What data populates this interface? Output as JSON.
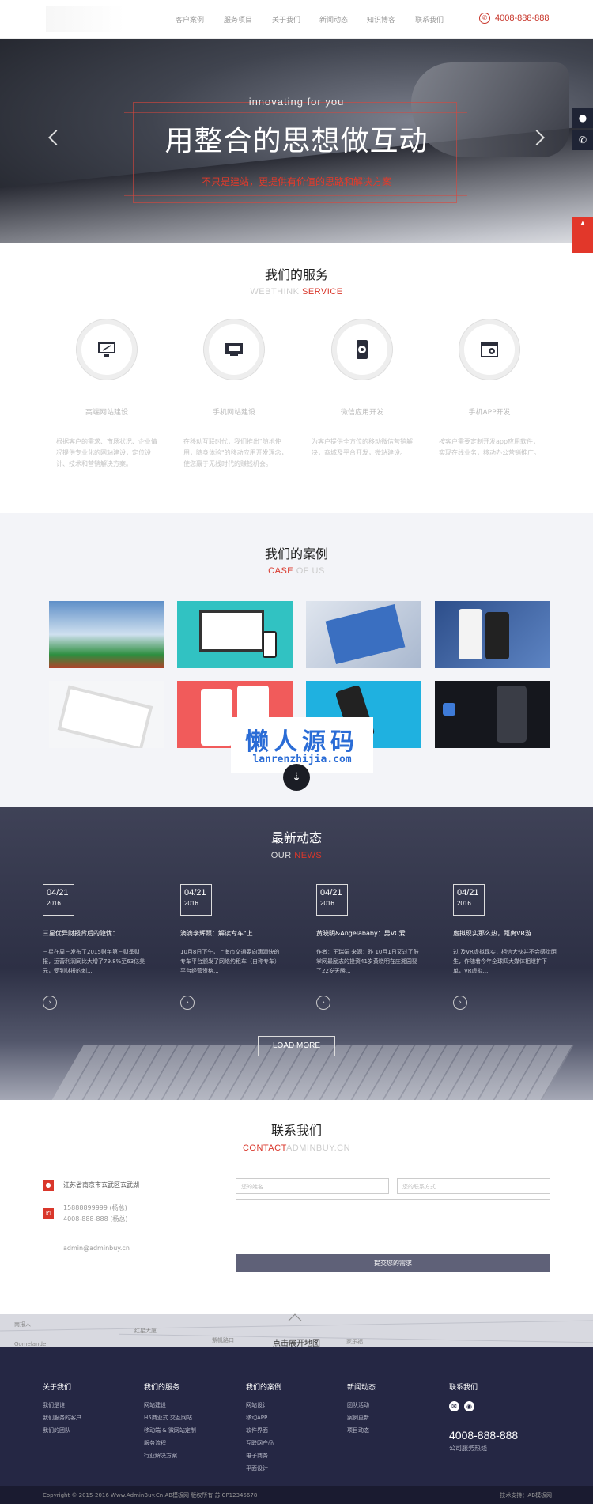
{
  "nav": {
    "items": [
      "客户案例",
      "服务项目",
      "关于我们",
      "新闻动态",
      "知识博客",
      "联系我们"
    ],
    "phone": "4008-888-888"
  },
  "hero": {
    "subtitle": "innovating for you",
    "title": "用整合的思想做互动",
    "tagline": "不只是建站，更提供有价值的思路和解决方案"
  },
  "services": {
    "title": "我们的服务",
    "subtitle_a": "WEBTHINK ",
    "subtitle_b": "SERVICE",
    "items": [
      {
        "icon": "monitor-icon",
        "name": "高端网站建设",
        "desc": "根据客户的需求、市场状况、企业情况提供专业化的网站建设，定位设计、技术和营销解决方案。"
      },
      {
        "icon": "web-icon",
        "name": "手机网站建设",
        "desc": "在移动互联时代，我们推出\"随地使用，随身体验\"的移动应用开发理念，使您赢于无线时代的赚钱机会。"
      },
      {
        "icon": "mobile-gear-icon",
        "name": "微信应用开发",
        "desc": "为客户提供全方位的移动微信营销解决，商城及平台开发，微站建设。"
      },
      {
        "icon": "app-gear-icon",
        "name": "手机APP开发",
        "desc": "按客户需要定制开发app应用软件，实现在线业务，移动办公营销推广。"
      }
    ]
  },
  "cases": {
    "title": "我们的案例",
    "subtitle_a": "CASE",
    "subtitle_b": " OF US"
  },
  "watermark": {
    "cn": "懒人源码",
    "en": "lanrenzhijia.com"
  },
  "news": {
    "title": "最新动态",
    "subtitle_a": "OUR ",
    "subtitle_b": "NEWS",
    "items": [
      {
        "day": "04/21",
        "year": "2016",
        "title": "三星优异财报背后的隐忧：",
        "text": "三星在周三发布了2015财年第三财季财报，运营利润同比大增了79.8%至63亿美元，受到财报的刺..."
      },
      {
        "day": "04/21",
        "year": "2016",
        "title": "滴滴李辉照：解读专车\"上",
        "text": "10月8日下午，上海市交通委向滴滴快的专车平台颁发了网络约租车（自称专车）平台经营资格..."
      },
      {
        "day": "04/21",
        "year": "2016",
        "title": "黄晓明&Angelababy：男VC爱",
        "text": "作者：王瑞娟 来源：昨 10月1日又过了鼓掌网最励志的投资41岁黄晓明在庄湘园娶了22岁天勝..."
      },
      {
        "day": "04/21",
        "year": "2016",
        "title": "虚拟现实那么热，距离VR游",
        "text": "过 及VR虚拟现实，相信大伙并不会感觉陌生，作随着今年全球四大媒体相继扩下单，VR虚拟..."
      }
    ],
    "load_more": "LOAD MORE"
  },
  "contact": {
    "title": "联系我们",
    "subtitle_a": "CONTACT",
    "subtitle_b": "ADMINBUY.CN",
    "address": "江苏省南京市玄武区玄武湖",
    "phone1": "15888899999 (杨总)",
    "phone2": "4008-888-888 (杨总)",
    "email": "admin@adminbuy.cn",
    "name_ph": "您的姓名",
    "phone_ph": "您的联系方式",
    "submit": "提交您的需求"
  },
  "map": {
    "open_label": "点击展开地图",
    "labels": [
      "南报人",
      "Gomelande",
      "红星大厦",
      "家乐福",
      "紫帆路口"
    ]
  },
  "footer": {
    "cols": [
      {
        "title": "关于我们",
        "links": [
          "我们是谁",
          "我们服务的客户",
          "我们的团队"
        ]
      },
      {
        "title": "我们的服务",
        "links": [
          "网站建设",
          "H5商业式 交互网站",
          "移动端 & 微网站定制",
          "服务流程",
          "行业解决方案"
        ]
      },
      {
        "title": "我们的案例",
        "links": [
          "网站设计",
          "移动APP",
          "软件界面",
          "互联网产品",
          "电子商务",
          "平面设计"
        ]
      },
      {
        "title": "新闻动态",
        "links": [
          "团队活动",
          "案例更新",
          "项目动态"
        ]
      }
    ],
    "contact_title": "联系我们",
    "phone": "4008-888-888",
    "phone_label": "公司服务热线",
    "copyright": "Copyright © 2015-2016 Www.AdminBuy.Cn AB模板网 版权所有 苏ICP12345678",
    "tech": "技术支持：AB模板网"
  },
  "colors": {
    "accent": "#d9372b",
    "footer_bg": "#252744",
    "news_bg": "#2d3045"
  }
}
